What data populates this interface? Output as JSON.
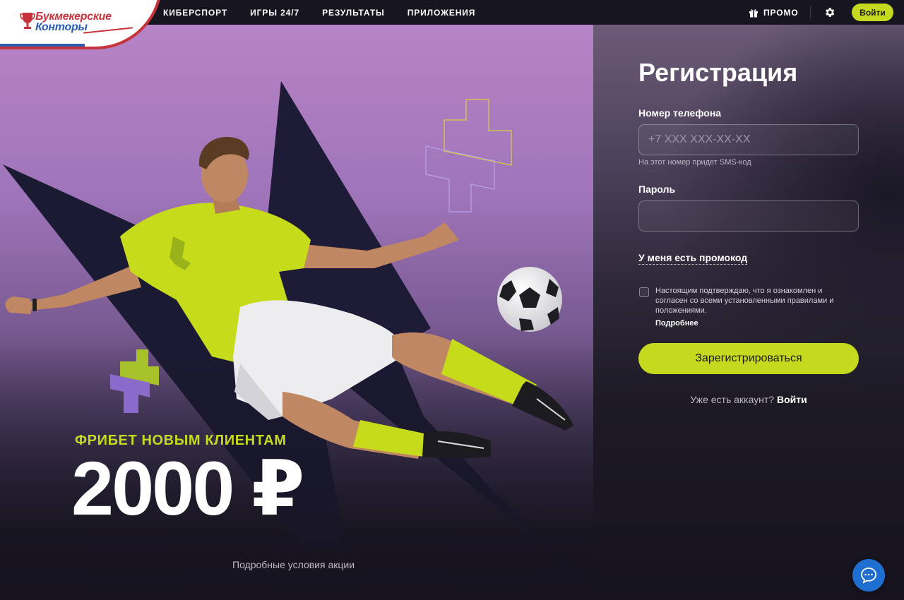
{
  "brand": {
    "logo_line1": "Букмекерские",
    "logo_line2": "Конторы",
    "colors": {
      "red": "#c8323a",
      "blue": "#2b5fb3"
    }
  },
  "nav": {
    "items": [
      {
        "label": "КИБЕРСПОРТ"
      },
      {
        "label": "ИГРЫ 24/7"
      },
      {
        "label": "РЕЗУЛЬТАТЫ"
      },
      {
        "label": "ПРИЛОЖЕНИЯ"
      }
    ],
    "promo_label": "ПРОМО",
    "promo_icon": "gift-icon",
    "settings_icon": "gear-icon",
    "login_label": "Войти"
  },
  "hero": {
    "freebet_label": "ФРИБЕТ НОВЫМ КЛИЕНТАМ",
    "freebet_amount": "2000 ₽",
    "terms_link": "Подробные условия акции"
  },
  "registration": {
    "title": "Регистрация",
    "phone_label": "Номер телефона",
    "phone_placeholder": "+7 XXX XXX-XX-XX",
    "phone_value": "",
    "phone_hint": "На этот номер придет SMS-код",
    "password_label": "Пароль",
    "password_value": "",
    "promo_toggle": "У меня есть промокод",
    "consent_checked": false,
    "consent_text": "Настоящим подтверждаю, что я ознакомлен и согласен со всеми установленными правилами и положениями.",
    "consent_more": "Подробнее",
    "submit_label": "Зарегистрироваться",
    "have_account": "Уже есть аккаунт?",
    "login_link": "Войти"
  },
  "chat": {
    "icon": "chat-bubble-icon"
  },
  "colors": {
    "accent": "#c5da1f",
    "background": "#16131f",
    "chat": "#1f6fd1"
  }
}
